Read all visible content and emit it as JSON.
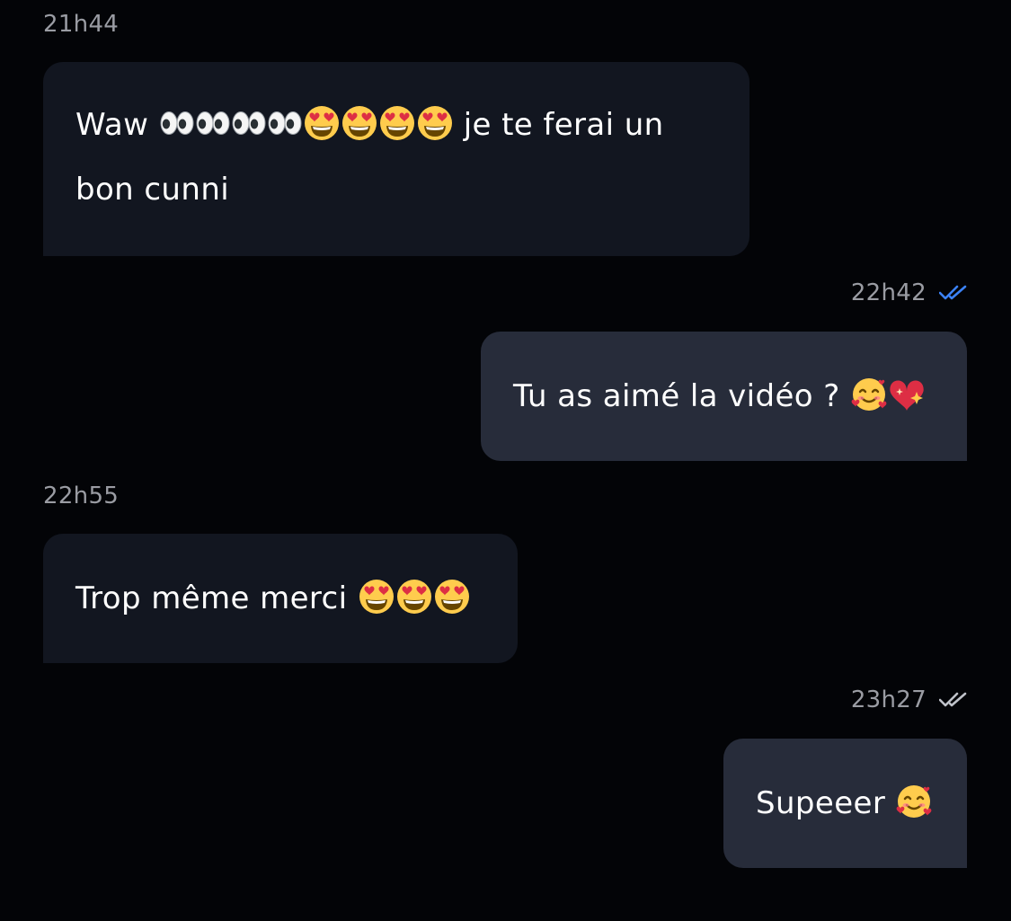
{
  "conversation": {
    "messages": [
      {
        "direction": "incoming",
        "time": "21h44",
        "text_before": "Waw ",
        "emojis": [
          "eyes",
          "eyes",
          "eyes",
          "eyes",
          "heart-eyes",
          "heart-eyes",
          "heart-eyes",
          "heart-eyes"
        ],
        "text_after": " je te ferai un bon cunni"
      },
      {
        "direction": "outgoing",
        "time": "22h42",
        "read_status": "read",
        "read_color": "#3b82f6",
        "text_before": "Tu as aimé la vidéo ? ",
        "emojis": [
          "smiling-face-with-hearts",
          "sparkling-heart"
        ]
      },
      {
        "direction": "incoming",
        "time": "22h55",
        "text_before": "Trop même merci ",
        "emojis": [
          "heart-eyes",
          "heart-eyes",
          "heart-eyes"
        ]
      },
      {
        "direction": "outgoing",
        "time": "23h27",
        "read_status": "delivered",
        "read_color": "#bfc2c9",
        "text_before": "Supeeer ",
        "emojis": [
          "smiling-face-with-hearts"
        ]
      }
    ]
  },
  "colors": {
    "background": "#030407",
    "incoming_bubble": "#121620",
    "outgoing_bubble": "#272c3a",
    "timestamp": "#9a9ca3"
  }
}
